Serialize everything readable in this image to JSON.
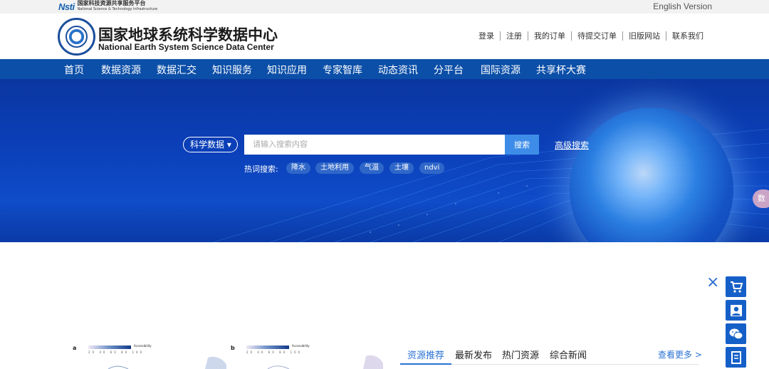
{
  "topbar": {
    "nsti_mark": "Nsti",
    "nsti_cn": "国家科技资源共享服务平台",
    "nsti_en": "National Science & Technology Infrastructure",
    "english_version": "English Version"
  },
  "header": {
    "title_cn": "国家地球系统科学数据中心",
    "title_en": "National Earth System Science Data Center",
    "user_links": [
      "登录",
      "注册",
      "我的订单",
      "待提交订单",
      "旧版网站",
      "联系我们"
    ]
  },
  "nav": {
    "items": [
      "首页",
      "数据资源",
      "数据汇交",
      "知识服务",
      "知识应用",
      "专家智库",
      "动态资讯",
      "分平台",
      "国际资源",
      "共享杯大赛"
    ]
  },
  "hero": {
    "search_scope": "科学数据 ▾",
    "search_placeholder": "请输入搜索内容",
    "search_button": "搜索",
    "advanced_search": "高级搜索",
    "hot_label": "热词搜索:",
    "hot_tags": [
      "降水",
      "土地利用",
      "气温",
      "土壤",
      "ndvi"
    ],
    "side_tab": "数"
  },
  "figures": [
    {
      "letter": "a",
      "legend": "Accessibility",
      "ticks": "20 40 60 80 100"
    },
    {
      "letter": "b",
      "legend": "Accessibility",
      "ticks": "20 40 60 80 100"
    }
  ],
  "tabs": {
    "items": [
      "资源推荐",
      "最新发布",
      "热门资源",
      "综合新闻"
    ],
    "active": "资源推荐",
    "more": "查看更多 >"
  },
  "floating": {
    "close": "×",
    "buttons": [
      "cart-icon",
      "user-icon",
      "wechat-icon",
      "book-icon"
    ]
  },
  "colors": {
    "nav_bg": "#0c4fa8",
    "accent": "#2a72d4",
    "float_btn": "#1560c8"
  }
}
